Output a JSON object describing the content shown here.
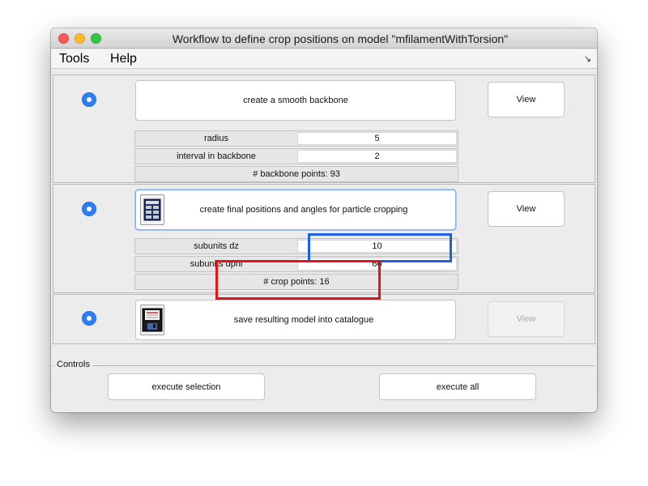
{
  "window": {
    "title": "Workflow to define crop positions on model \"mfilamentWithTorsion\""
  },
  "menubar": {
    "items": [
      "Tools",
      "Help"
    ],
    "toolbar_toggle": "↘"
  },
  "steps": [
    {
      "label": "create a smooth backbone",
      "view_label": "View",
      "view_enabled": true,
      "params": [
        {
          "label": "radius",
          "value": "5"
        },
        {
          "label": "interval in backbone",
          "value": "2"
        }
      ],
      "info": "# backbone points: 93"
    },
    {
      "label": "create final positions and angles for particle cropping",
      "view_label": "View",
      "view_enabled": true,
      "icon": "table-icon",
      "params": [
        {
          "label": "subunits dz",
          "value": "10"
        },
        {
          "label": "subunits dphi",
          "value": "60"
        }
      ],
      "info": "# crop points: 16"
    },
    {
      "label": "save resulting model into catalogue",
      "view_label": "View",
      "view_enabled": false,
      "icon": "floppy-save-icon"
    }
  ],
  "controls": {
    "title": "Controls",
    "execute_selection_label": "execute selection",
    "execute_all_label": "execute all"
  },
  "colors": {
    "radio_selected": "#2b7ef6",
    "annotation_blue": "#1f5fe0",
    "annotation_red": "#e0141b"
  }
}
